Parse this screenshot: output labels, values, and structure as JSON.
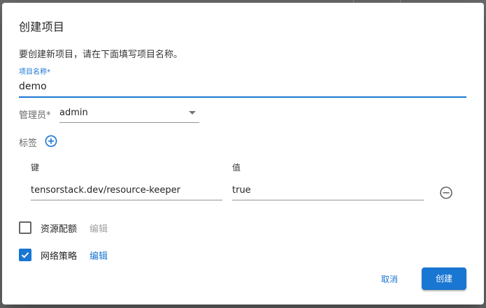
{
  "dialog": {
    "title": "创建项目",
    "intro": "要创建新项目，请在下面填写项目名称。"
  },
  "project_name": {
    "label": "项目名称",
    "required_mark": "*",
    "value": "demo"
  },
  "admin": {
    "label": "管理员",
    "required_mark": "*",
    "value": "admin"
  },
  "tags": {
    "label": "标签",
    "key_header": "键",
    "value_header": "值",
    "rows": [
      {
        "key": "tensorstack.dev/resource-keeper",
        "value": "true"
      }
    ]
  },
  "resource_quota": {
    "label": "资源配额",
    "checked": false,
    "edit_label": "编辑"
  },
  "network_policy": {
    "label": "网络策略",
    "checked": true,
    "edit_label": "编辑"
  },
  "actions": {
    "cancel_label": "取消",
    "create_label": "创建"
  },
  "colors": {
    "accent": "#1976d2",
    "backdrop": "#6b6b6b"
  },
  "icons": {
    "add_tag": "add-circle-outline-icon",
    "remove_tag": "remove-circle-outline-icon",
    "checkbox_checked": "check-icon",
    "dropdown": "arrow-drop-down-icon"
  }
}
